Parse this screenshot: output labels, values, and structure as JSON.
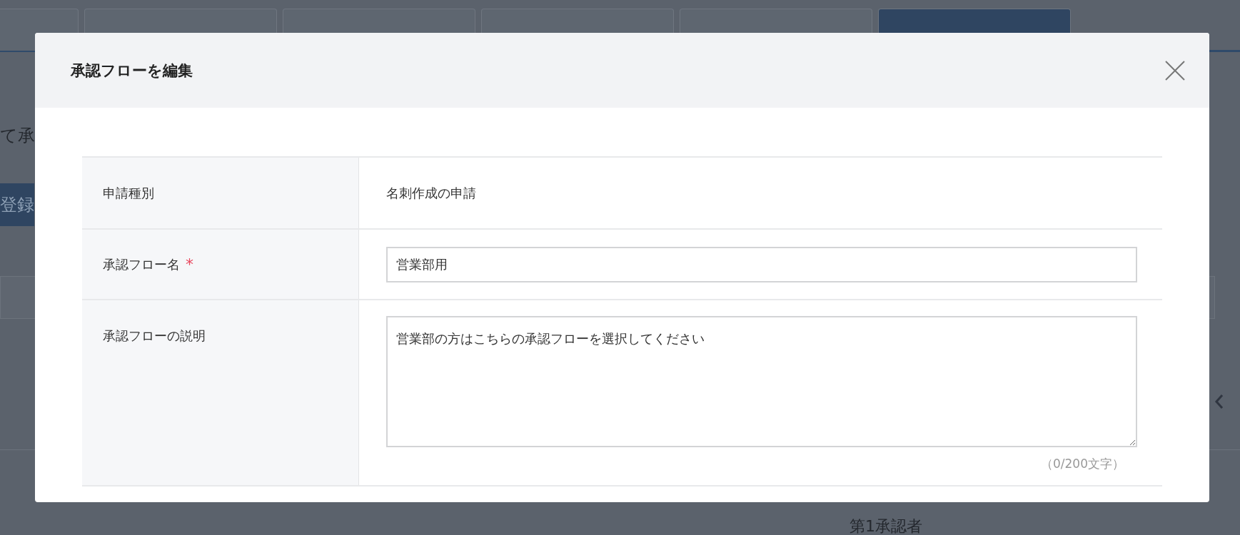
{
  "background_page": {
    "heading_fragment": "て承",
    "register_button": "登録",
    "table_header_fragment": "第1承認者",
    "tabs": [
      {
        "selected": false
      },
      {
        "selected": false
      },
      {
        "selected": false
      },
      {
        "selected": false
      },
      {
        "selected": false
      },
      {
        "selected": true
      }
    ]
  },
  "modal": {
    "title": "承認フローを編集",
    "rows": [
      {
        "kind": "text",
        "label": "申請種別",
        "value": "名刺作成の申請"
      },
      {
        "kind": "input",
        "label": "承認フロー名",
        "required_mark": "*",
        "value": "営業部用"
      },
      {
        "kind": "textarea",
        "label": "承認フローの説明",
        "value": "営業部の方はこちらの承認フローを選択してください",
        "counter": "（0/200文字）"
      }
    ]
  }
}
